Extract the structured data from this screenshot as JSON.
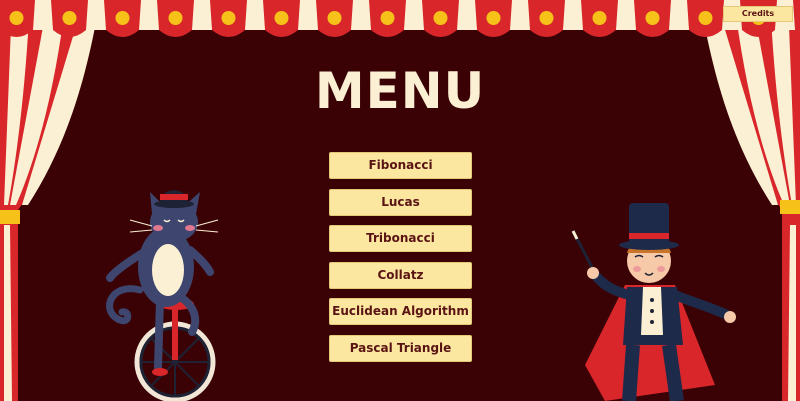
{
  "title": "MENU",
  "credits_label": "Credits",
  "menu": {
    "items": [
      {
        "label": "Fibonacci"
      },
      {
        "label": "Lucas"
      },
      {
        "label": "Tribonacci"
      },
      {
        "label": "Collatz"
      },
      {
        "label": "Euclidean Algorithm"
      },
      {
        "label": "Pascal Triangle"
      }
    ]
  },
  "colors": {
    "background": "#3a0205",
    "curtain_red": "#d8262a",
    "curtain_cream": "#fbf0d3",
    "valance_gold": "#f6c21a",
    "button_fill": "#fbe79f",
    "button_text": "#5a1414"
  },
  "illustrations": [
    "cat-on-unicycle",
    "magician-with-wand"
  ]
}
